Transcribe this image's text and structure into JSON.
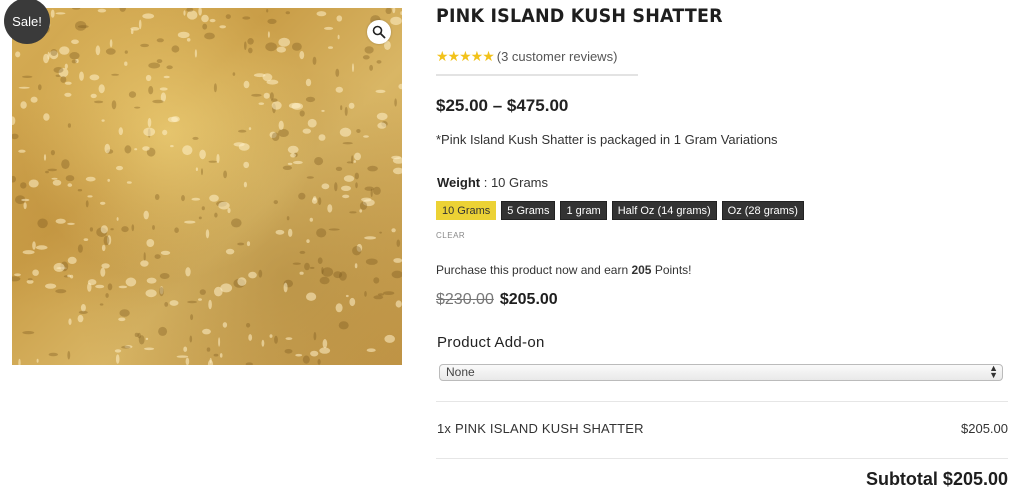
{
  "product": {
    "title": "PINK ISLAND KUSH SHATTER",
    "sale_badge": "Sale!",
    "rating": {
      "value": 5,
      "max": 5,
      "stars_text": "★★★★★",
      "reviews_text": "(3 customer reviews)",
      "star_color": "#f2c21a"
    },
    "price_range": "$25.00 – $475.00",
    "short_description": "*Pink Island Kush Shatter is packaged in 1 Gram Variations",
    "weight": {
      "label": "Weight",
      "selected_value": "10 Grams",
      "options": [
        "10 Grams",
        "5 Grams",
        "1 gram",
        "Half Oz (14 grams)",
        "Oz (28 grams)"
      ],
      "clear_label": "CLEAR",
      "selected_color": "#ecd235"
    },
    "points": {
      "prefix": "Purchase this product now and earn ",
      "amount": "205",
      "suffix": " Points!"
    },
    "variation_price": {
      "old": "$230.00",
      "new": "$205.00"
    },
    "addon": {
      "heading": "Product Add-on",
      "selected": "None"
    },
    "summary": {
      "line_name": "1x PINK ISLAND KUSH SHATTER",
      "line_price": "$205.00",
      "subtotal": "Subtotal $205.00"
    }
  },
  "icons": {
    "zoom": "magnifier-icon",
    "select_arrows": "updown-arrows-icon"
  }
}
